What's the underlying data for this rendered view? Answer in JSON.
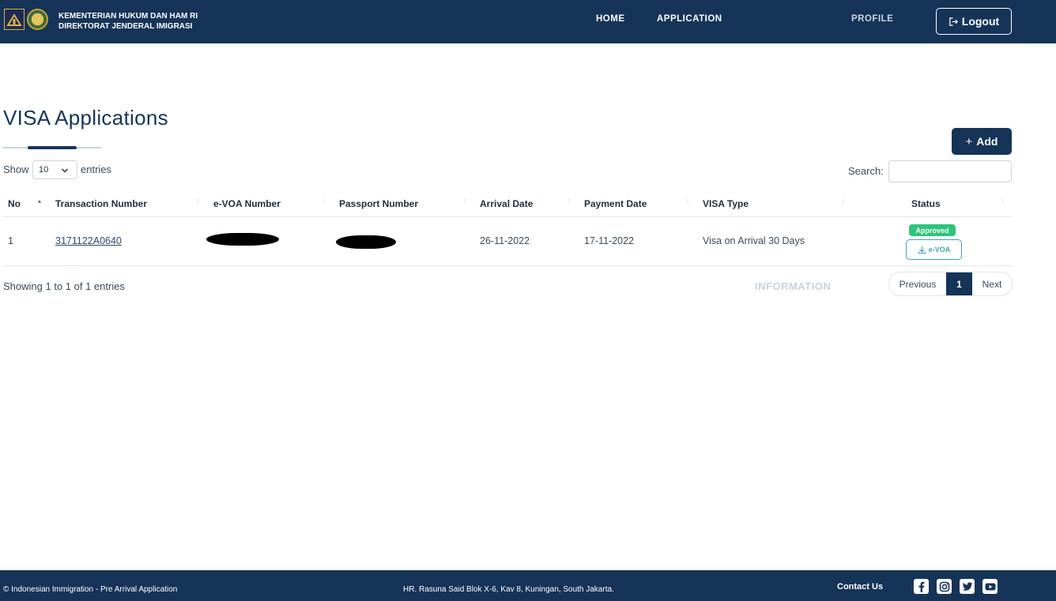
{
  "header": {
    "brand_line1": "KEMENTERIAN HUKUM DAN HAM RI",
    "brand_line2": "DIREKTORAT JENDERAL IMIGRASI",
    "nav": [
      "HOME",
      "APPLICATION",
      "INFORMATION",
      "PROFILE"
    ],
    "logout_label": "Logout"
  },
  "page": {
    "title": "VISA Applications",
    "add_label": "Add"
  },
  "controls": {
    "show_label": "Show",
    "page_length": "10",
    "entries_label": "entries",
    "search_label": "Search:",
    "search_value": ""
  },
  "table": {
    "columns": [
      "No",
      "Transaction Number",
      "e-VOA Number",
      "Passport Number",
      "Arrival Date",
      "Payment Date",
      "VISA Type",
      "Status"
    ],
    "rows": [
      {
        "no": "1",
        "transaction_number": "3171122A0640",
        "evoa_number": "",
        "passport_number": "",
        "arrival_date": "26-11-2022",
        "payment_date": "17-11-2022",
        "visa_type": "Visa on Arrival 30 Days",
        "status": "Approved",
        "download_label": "e-VOA"
      }
    ]
  },
  "pagination": {
    "info": "Showing 1 to 1 of 1 entries",
    "previous": "Previous",
    "current": "1",
    "next": "Next"
  },
  "footer": {
    "copyright": "© Indonesian Immigration - Pre Arrival Application",
    "address": "HR. Rasuna Said Blok X-6, Kav 8, Kuningan, South Jakarta.",
    "contact": "Contact Us"
  },
  "colors": {
    "primary": "#163458",
    "approved": "#2ec57a",
    "download": "#3fa2b8"
  }
}
